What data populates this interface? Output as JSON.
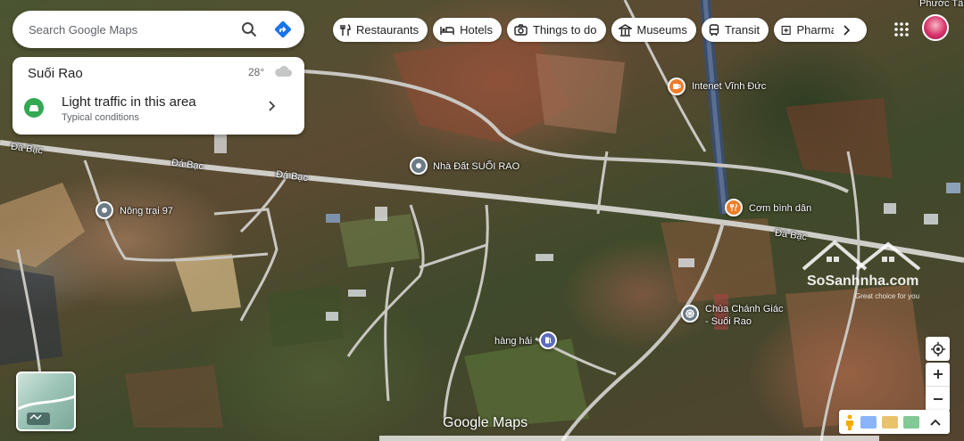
{
  "search": {
    "placeholder": "Search Google Maps"
  },
  "chips": [
    {
      "label": "Restaurants",
      "icon": "fork-knife-icon"
    },
    {
      "label": "Hotels",
      "icon": "bed-icon"
    },
    {
      "label": "Things to do",
      "icon": "camera-icon"
    },
    {
      "label": "Museums",
      "icon": "museum-icon"
    },
    {
      "label": "Transit",
      "icon": "train-icon"
    },
    {
      "label": "Pharmacies",
      "icon": "pharmacy-icon"
    }
  ],
  "info_card": {
    "place": "Suối Rao",
    "temperature": "28°",
    "traffic_title": "Light traffic in this area",
    "traffic_subtitle": "Typical conditions"
  },
  "map_labels": {
    "road_1": "Đá Bạc",
    "road_2": "Đá Bạc",
    "road_3": "Đá Bạc",
    "road_4": "Đá Bạc",
    "corner": "Phước Tân"
  },
  "places": [
    {
      "name": "Nhà Đất SUỐI RAO",
      "type": "grey"
    },
    {
      "name": "Nông trại 97",
      "type": "grey"
    },
    {
      "name": "Intenet Vĩnh Đức",
      "type": "orange"
    },
    {
      "name": "Cơm bình dân",
      "type": "orange"
    },
    {
      "name": "Chùa Chánh Giác - Suối Rao",
      "type": "grey"
    },
    {
      "name": "hàng hải",
      "type": "blue"
    }
  ],
  "watermark": {
    "name": "SoSanhnha.com",
    "tagline": "Great choice for you"
  },
  "footer": {
    "logo": "Google Maps"
  },
  "colors": {
    "road": "#c9c7c2",
    "accent_blue": "#1a73e8",
    "traffic_green": "#34a853",
    "poi_orange": "#ee7d2b",
    "poi_blue": "#5c6bc0"
  }
}
